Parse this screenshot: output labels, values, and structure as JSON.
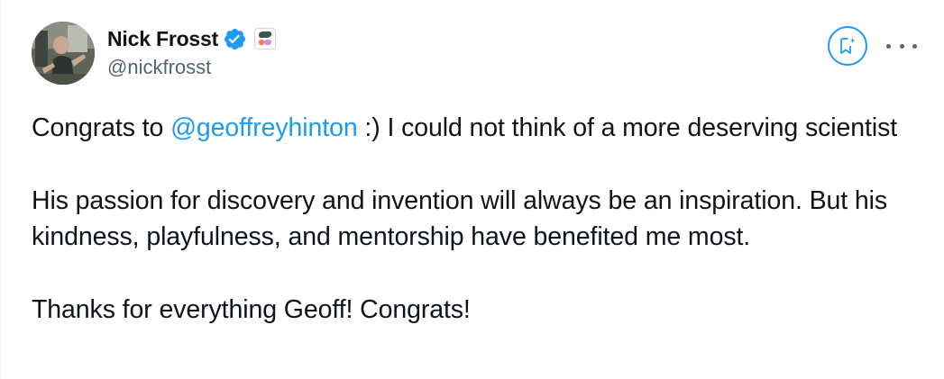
{
  "author": {
    "display_name": "Nick Frosst",
    "handle": "@nickfrosst"
  },
  "icons": {
    "verified": "verified-badge-icon",
    "affiliate": "affiliate-logo-icon",
    "grok": "grok-explain-icon",
    "more": "more-options-icon"
  },
  "colors": {
    "accent": "#1d9bf0",
    "text": "#0f1419",
    "secondary": "#536471"
  },
  "tweet": {
    "line1_before": "Congrats to ",
    "mention": "@geoffreyhinton",
    "line1_after": " :) I could not think of a more deserving scientist",
    "paragraph2": "His passion for discovery and invention will always be an inspiration. But his kindness, playfulness, and mentorship have benefited me most.",
    "paragraph3": "Thanks for everything Geoff! Congrats!"
  }
}
